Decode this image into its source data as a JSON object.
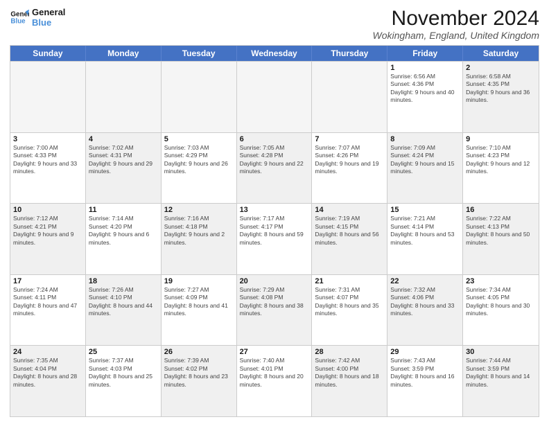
{
  "logo": {
    "line1": "General",
    "line2": "Blue"
  },
  "title": "November 2024",
  "location": "Wokingham, England, United Kingdom",
  "headers": [
    "Sunday",
    "Monday",
    "Tuesday",
    "Wednesday",
    "Thursday",
    "Friday",
    "Saturday"
  ],
  "rows": [
    [
      {
        "day": "",
        "info": "",
        "empty": true
      },
      {
        "day": "",
        "info": "",
        "empty": true
      },
      {
        "day": "",
        "info": "",
        "empty": true
      },
      {
        "day": "",
        "info": "",
        "empty": true
      },
      {
        "day": "",
        "info": "",
        "empty": true
      },
      {
        "day": "1",
        "info": "Sunrise: 6:56 AM\nSunset: 4:36 PM\nDaylight: 9 hours and 40 minutes.",
        "empty": false
      },
      {
        "day": "2",
        "info": "Sunrise: 6:58 AM\nSunset: 4:35 PM\nDaylight: 9 hours and 36 minutes.",
        "empty": false,
        "shaded": true
      }
    ],
    [
      {
        "day": "3",
        "info": "Sunrise: 7:00 AM\nSunset: 4:33 PM\nDaylight: 9 hours and 33 minutes.",
        "empty": false
      },
      {
        "day": "4",
        "info": "Sunrise: 7:02 AM\nSunset: 4:31 PM\nDaylight: 9 hours and 29 minutes.",
        "empty": false,
        "shaded": true
      },
      {
        "day": "5",
        "info": "Sunrise: 7:03 AM\nSunset: 4:29 PM\nDaylight: 9 hours and 26 minutes.",
        "empty": false
      },
      {
        "day": "6",
        "info": "Sunrise: 7:05 AM\nSunset: 4:28 PM\nDaylight: 9 hours and 22 minutes.",
        "empty": false,
        "shaded": true
      },
      {
        "day": "7",
        "info": "Sunrise: 7:07 AM\nSunset: 4:26 PM\nDaylight: 9 hours and 19 minutes.",
        "empty": false
      },
      {
        "day": "8",
        "info": "Sunrise: 7:09 AM\nSunset: 4:24 PM\nDaylight: 9 hours and 15 minutes.",
        "empty": false,
        "shaded": true
      },
      {
        "day": "9",
        "info": "Sunrise: 7:10 AM\nSunset: 4:23 PM\nDaylight: 9 hours and 12 minutes.",
        "empty": false
      }
    ],
    [
      {
        "day": "10",
        "info": "Sunrise: 7:12 AM\nSunset: 4:21 PM\nDaylight: 9 hours and 9 minutes.",
        "empty": false,
        "shaded": true
      },
      {
        "day": "11",
        "info": "Sunrise: 7:14 AM\nSunset: 4:20 PM\nDaylight: 9 hours and 6 minutes.",
        "empty": false
      },
      {
        "day": "12",
        "info": "Sunrise: 7:16 AM\nSunset: 4:18 PM\nDaylight: 9 hours and 2 minutes.",
        "empty": false,
        "shaded": true
      },
      {
        "day": "13",
        "info": "Sunrise: 7:17 AM\nSunset: 4:17 PM\nDaylight: 8 hours and 59 minutes.",
        "empty": false
      },
      {
        "day": "14",
        "info": "Sunrise: 7:19 AM\nSunset: 4:15 PM\nDaylight: 8 hours and 56 minutes.",
        "empty": false,
        "shaded": true
      },
      {
        "day": "15",
        "info": "Sunrise: 7:21 AM\nSunset: 4:14 PM\nDaylight: 8 hours and 53 minutes.",
        "empty": false
      },
      {
        "day": "16",
        "info": "Sunrise: 7:22 AM\nSunset: 4:13 PM\nDaylight: 8 hours and 50 minutes.",
        "empty": false,
        "shaded": true
      }
    ],
    [
      {
        "day": "17",
        "info": "Sunrise: 7:24 AM\nSunset: 4:11 PM\nDaylight: 8 hours and 47 minutes.",
        "empty": false
      },
      {
        "day": "18",
        "info": "Sunrise: 7:26 AM\nSunset: 4:10 PM\nDaylight: 8 hours and 44 minutes.",
        "empty": false,
        "shaded": true
      },
      {
        "day": "19",
        "info": "Sunrise: 7:27 AM\nSunset: 4:09 PM\nDaylight: 8 hours and 41 minutes.",
        "empty": false
      },
      {
        "day": "20",
        "info": "Sunrise: 7:29 AM\nSunset: 4:08 PM\nDaylight: 8 hours and 38 minutes.",
        "empty": false,
        "shaded": true
      },
      {
        "day": "21",
        "info": "Sunrise: 7:31 AM\nSunset: 4:07 PM\nDaylight: 8 hours and 35 minutes.",
        "empty": false
      },
      {
        "day": "22",
        "info": "Sunrise: 7:32 AM\nSunset: 4:06 PM\nDaylight: 8 hours and 33 minutes.",
        "empty": false,
        "shaded": true
      },
      {
        "day": "23",
        "info": "Sunrise: 7:34 AM\nSunset: 4:05 PM\nDaylight: 8 hours and 30 minutes.",
        "empty": false
      }
    ],
    [
      {
        "day": "24",
        "info": "Sunrise: 7:35 AM\nSunset: 4:04 PM\nDaylight: 8 hours and 28 minutes.",
        "empty": false,
        "shaded": true
      },
      {
        "day": "25",
        "info": "Sunrise: 7:37 AM\nSunset: 4:03 PM\nDaylight: 8 hours and 25 minutes.",
        "empty": false
      },
      {
        "day": "26",
        "info": "Sunrise: 7:39 AM\nSunset: 4:02 PM\nDaylight: 8 hours and 23 minutes.",
        "empty": false,
        "shaded": true
      },
      {
        "day": "27",
        "info": "Sunrise: 7:40 AM\nSunset: 4:01 PM\nDaylight: 8 hours and 20 minutes.",
        "empty": false
      },
      {
        "day": "28",
        "info": "Sunrise: 7:42 AM\nSunset: 4:00 PM\nDaylight: 8 hours and 18 minutes.",
        "empty": false,
        "shaded": true
      },
      {
        "day": "29",
        "info": "Sunrise: 7:43 AM\nSunset: 3:59 PM\nDaylight: 8 hours and 16 minutes.",
        "empty": false
      },
      {
        "day": "30",
        "info": "Sunrise: 7:44 AM\nSunset: 3:59 PM\nDaylight: 8 hours and 14 minutes.",
        "empty": false,
        "shaded": true
      }
    ]
  ]
}
